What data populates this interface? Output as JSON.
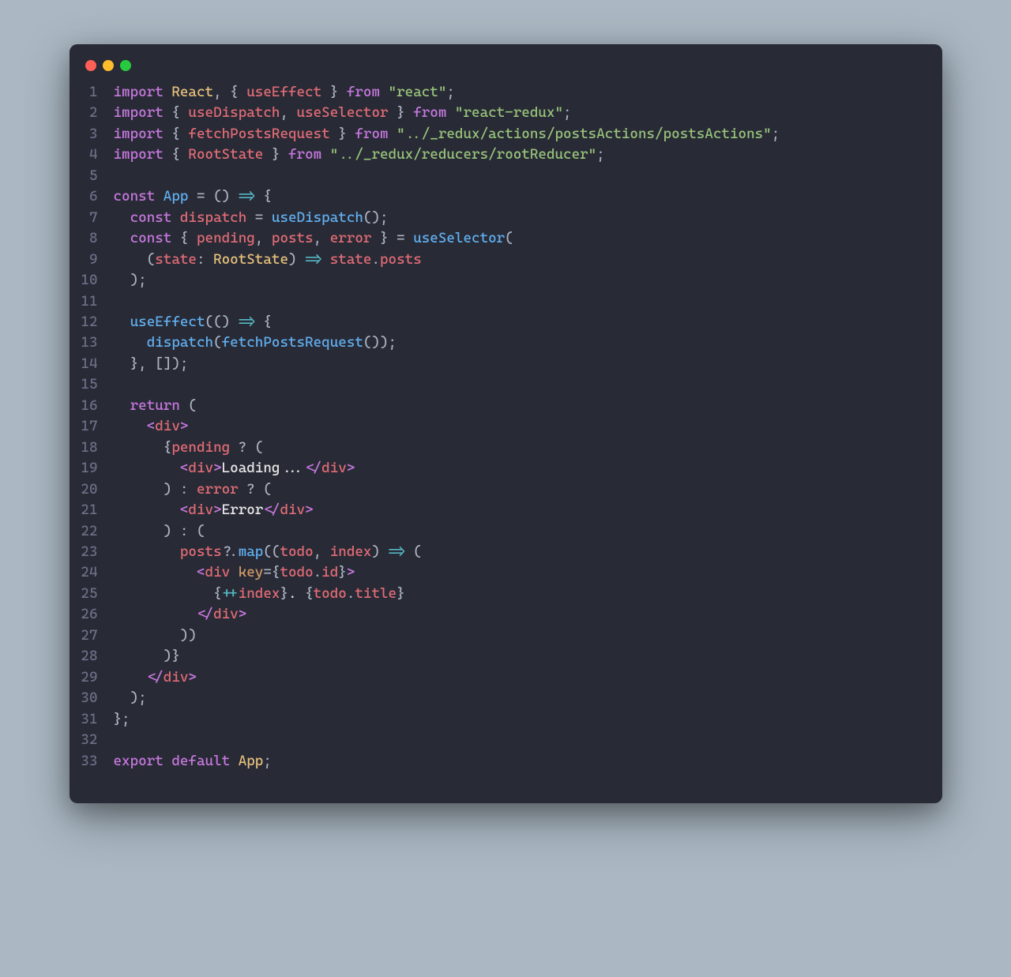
{
  "window": {
    "dots": [
      "red",
      "yellow",
      "green"
    ]
  },
  "code": {
    "lines": [
      {
        "n": 1,
        "tokens": [
          [
            "kw",
            "import"
          ],
          [
            "punc",
            " "
          ],
          [
            "def",
            "React"
          ],
          [
            "punc",
            ", { "
          ],
          [
            "var",
            "useEffect"
          ],
          [
            "punc",
            " } "
          ],
          [
            "kw",
            "from"
          ],
          [
            "punc",
            " "
          ],
          [
            "str",
            "\"react\""
          ],
          [
            "punc",
            ";"
          ]
        ]
      },
      {
        "n": 2,
        "tokens": [
          [
            "kw",
            "import"
          ],
          [
            "punc",
            " { "
          ],
          [
            "var",
            "useDispatch"
          ],
          [
            "punc",
            ", "
          ],
          [
            "var",
            "useSelector"
          ],
          [
            "punc",
            " } "
          ],
          [
            "kw",
            "from"
          ],
          [
            "punc",
            " "
          ],
          [
            "str",
            "\"react-redux\""
          ],
          [
            "punc",
            ";"
          ]
        ]
      },
      {
        "n": 3,
        "tokens": [
          [
            "kw",
            "import"
          ],
          [
            "punc",
            " { "
          ],
          [
            "var",
            "fetchPostsRequest"
          ],
          [
            "punc",
            " } "
          ],
          [
            "kw",
            "from"
          ],
          [
            "punc",
            " "
          ],
          [
            "str",
            "\"../_redux/actions/postsActions/postsActions\""
          ],
          [
            "punc",
            ";"
          ]
        ]
      },
      {
        "n": 4,
        "tokens": [
          [
            "kw",
            "import"
          ],
          [
            "punc",
            " { "
          ],
          [
            "var",
            "RootState"
          ],
          [
            "punc",
            " } "
          ],
          [
            "kw",
            "from"
          ],
          [
            "punc",
            " "
          ],
          [
            "str",
            "\"../_redux/reducers/rootReducer\""
          ],
          [
            "punc",
            ";"
          ]
        ]
      },
      {
        "n": 5,
        "tokens": [
          [
            "punc",
            ""
          ]
        ]
      },
      {
        "n": 6,
        "tokens": [
          [
            "kw",
            "const"
          ],
          [
            "punc",
            " "
          ],
          [
            "fn",
            "App"
          ],
          [
            "punc",
            " = () "
          ],
          [
            "op",
            "=>"
          ],
          [
            "punc",
            " {"
          ]
        ]
      },
      {
        "n": 7,
        "tokens": [
          [
            "punc",
            "  "
          ],
          [
            "kw",
            "const"
          ],
          [
            "punc",
            " "
          ],
          [
            "var",
            "dispatch"
          ],
          [
            "punc",
            " = "
          ],
          [
            "fn",
            "useDispatch"
          ],
          [
            "punc",
            "();"
          ]
        ]
      },
      {
        "n": 8,
        "tokens": [
          [
            "punc",
            "  "
          ],
          [
            "kw",
            "const"
          ],
          [
            "punc",
            " { "
          ],
          [
            "var",
            "pending"
          ],
          [
            "punc",
            ", "
          ],
          [
            "var",
            "posts"
          ],
          [
            "punc",
            ", "
          ],
          [
            "var",
            "error"
          ],
          [
            "punc",
            " } = "
          ],
          [
            "fn",
            "useSelector"
          ],
          [
            "punc",
            "("
          ]
        ]
      },
      {
        "n": 9,
        "tokens": [
          [
            "punc",
            "    ("
          ],
          [
            "var",
            "state"
          ],
          [
            "punc",
            ": "
          ],
          [
            "def",
            "RootState"
          ],
          [
            "punc",
            ") "
          ],
          [
            "op",
            "=>"
          ],
          [
            "punc",
            " "
          ],
          [
            "var",
            "state"
          ],
          [
            "punc",
            "."
          ],
          [
            "var",
            "posts"
          ]
        ]
      },
      {
        "n": 10,
        "tokens": [
          [
            "punc",
            "  );"
          ]
        ]
      },
      {
        "n": 11,
        "tokens": [
          [
            "punc",
            ""
          ]
        ]
      },
      {
        "n": 12,
        "tokens": [
          [
            "punc",
            "  "
          ],
          [
            "fn",
            "useEffect"
          ],
          [
            "punc",
            "(() "
          ],
          [
            "op",
            "=>"
          ],
          [
            "punc",
            " {"
          ]
        ]
      },
      {
        "n": 13,
        "tokens": [
          [
            "punc",
            "    "
          ],
          [
            "fn",
            "dispatch"
          ],
          [
            "punc",
            "("
          ],
          [
            "fn",
            "fetchPostsRequest"
          ],
          [
            "punc",
            "());"
          ]
        ]
      },
      {
        "n": 14,
        "tokens": [
          [
            "punc",
            "  }, []);"
          ]
        ]
      },
      {
        "n": 15,
        "tokens": [
          [
            "punc",
            ""
          ]
        ]
      },
      {
        "n": 16,
        "tokens": [
          [
            "punc",
            "  "
          ],
          [
            "kw",
            "return"
          ],
          [
            "punc",
            " ("
          ]
        ]
      },
      {
        "n": 17,
        "tokens": [
          [
            "punc",
            "    "
          ],
          [
            "brkt",
            "<"
          ],
          [
            "var",
            "div"
          ],
          [
            "brkt",
            ">"
          ]
        ]
      },
      {
        "n": 18,
        "tokens": [
          [
            "punc",
            "      {"
          ],
          [
            "var",
            "pending"
          ],
          [
            "punc",
            " ? ("
          ]
        ]
      },
      {
        "n": 19,
        "tokens": [
          [
            "punc",
            "        "
          ],
          [
            "brkt",
            "<"
          ],
          [
            "var",
            "div"
          ],
          [
            "brkt",
            ">"
          ],
          [
            "text",
            "Loading..."
          ],
          [
            "brkt",
            "</"
          ],
          [
            "var",
            "div"
          ],
          [
            "brkt",
            ">"
          ]
        ]
      },
      {
        "n": 20,
        "tokens": [
          [
            "punc",
            "      ) : "
          ],
          [
            "var",
            "error"
          ],
          [
            "punc",
            " ? ("
          ]
        ]
      },
      {
        "n": 21,
        "tokens": [
          [
            "punc",
            "        "
          ],
          [
            "brkt",
            "<"
          ],
          [
            "var",
            "div"
          ],
          [
            "brkt",
            ">"
          ],
          [
            "text",
            "Error"
          ],
          [
            "brkt",
            "</"
          ],
          [
            "var",
            "div"
          ],
          [
            "brkt",
            ">"
          ]
        ]
      },
      {
        "n": 22,
        "tokens": [
          [
            "punc",
            "      ) : ("
          ]
        ]
      },
      {
        "n": 23,
        "tokens": [
          [
            "punc",
            "        "
          ],
          [
            "var",
            "posts"
          ],
          [
            "punc",
            "?."
          ],
          [
            "fn",
            "map"
          ],
          [
            "punc",
            "(("
          ],
          [
            "var",
            "todo"
          ],
          [
            "punc",
            ", "
          ],
          [
            "var",
            "index"
          ],
          [
            "punc",
            ") "
          ],
          [
            "op",
            "=>"
          ],
          [
            "punc",
            " ("
          ]
        ]
      },
      {
        "n": 24,
        "tokens": [
          [
            "punc",
            "          "
          ],
          [
            "brkt",
            "<"
          ],
          [
            "var",
            "div"
          ],
          [
            "punc",
            " "
          ],
          [
            "attr",
            "key"
          ],
          [
            "punc",
            "={"
          ],
          [
            "var",
            "todo"
          ],
          [
            "punc",
            "."
          ],
          [
            "var",
            "id"
          ],
          [
            "punc",
            "}"
          ],
          [
            "brkt",
            ">"
          ]
        ]
      },
      {
        "n": 25,
        "tokens": [
          [
            "punc",
            "            {"
          ],
          [
            "op",
            "++"
          ],
          [
            "var",
            "index"
          ],
          [
            "punc",
            "}"
          ],
          [
            "text",
            ". "
          ],
          [
            "punc",
            "{"
          ],
          [
            "var",
            "todo"
          ],
          [
            "punc",
            "."
          ],
          [
            "var",
            "title"
          ],
          [
            "punc",
            "}"
          ]
        ]
      },
      {
        "n": 26,
        "tokens": [
          [
            "punc",
            "          "
          ],
          [
            "brkt",
            "</"
          ],
          [
            "var",
            "div"
          ],
          [
            "brkt",
            ">"
          ]
        ]
      },
      {
        "n": 27,
        "tokens": [
          [
            "punc",
            "        ))"
          ]
        ]
      },
      {
        "n": 28,
        "tokens": [
          [
            "punc",
            "      )}"
          ]
        ]
      },
      {
        "n": 29,
        "tokens": [
          [
            "punc",
            "    "
          ],
          [
            "brkt",
            "</"
          ],
          [
            "var",
            "div"
          ],
          [
            "brkt",
            ">"
          ]
        ]
      },
      {
        "n": 30,
        "tokens": [
          [
            "punc",
            "  );"
          ]
        ]
      },
      {
        "n": 31,
        "tokens": [
          [
            "punc",
            "};"
          ]
        ]
      },
      {
        "n": 32,
        "tokens": [
          [
            "punc",
            ""
          ]
        ]
      },
      {
        "n": 33,
        "tokens": [
          [
            "kw",
            "export"
          ],
          [
            "punc",
            " "
          ],
          [
            "kw",
            "default"
          ],
          [
            "punc",
            " "
          ],
          [
            "def",
            "App"
          ],
          [
            "punc",
            ";"
          ]
        ]
      }
    ]
  }
}
